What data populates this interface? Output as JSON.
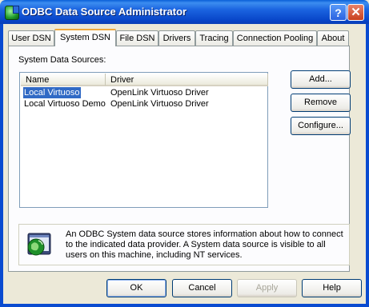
{
  "window": {
    "title": "ODBC Data Source Administrator",
    "help_glyph": "?",
    "close_glyph": "✕"
  },
  "tabs": [
    {
      "label": "User DSN"
    },
    {
      "label": "System DSN"
    },
    {
      "label": "File DSN"
    },
    {
      "label": "Drivers"
    },
    {
      "label": "Tracing"
    },
    {
      "label": "Connection Pooling"
    },
    {
      "label": "About"
    }
  ],
  "active_tab": "System DSN",
  "section_label": "System Data Sources:",
  "list": {
    "columns": [
      "Name",
      "Driver"
    ],
    "rows": [
      {
        "name": "Local Virtuoso",
        "driver": "OpenLink Virtuoso Driver",
        "selected": true
      },
      {
        "name": "Local Virtuoso Demo",
        "driver": "OpenLink Virtuoso Driver",
        "selected": false
      }
    ]
  },
  "side_buttons": {
    "add": "Add...",
    "remove": "Remove",
    "configure": "Configure..."
  },
  "info_text": "An ODBC System data source stores information about how to connect to the indicated data provider.  A System data source is visible to all users on this machine, including NT services.",
  "footer_buttons": {
    "ok": "OK",
    "cancel": "Cancel",
    "apply": "Apply",
    "help": "Help"
  },
  "colors": {
    "titlebar": "#0a4bd0",
    "selection": "#316ac5",
    "dialog_bg": "#ece9d8",
    "active_tab_accent": "#f0a93c"
  }
}
